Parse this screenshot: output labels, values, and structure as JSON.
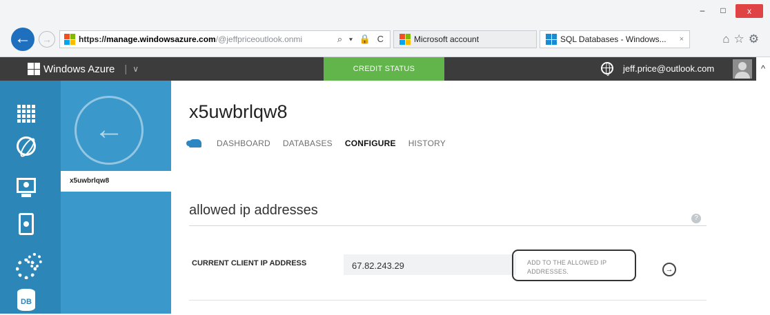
{
  "window": {
    "minimize": "–",
    "maximize": "□",
    "close": "x"
  },
  "browser": {
    "address": {
      "scheme": "https://",
      "host": "manage.windowsazure.com",
      "path": "/@jeffpriceoutlook.onmi"
    },
    "address_tools": "⌕ ▾ 🔒 C",
    "tabs": [
      {
        "label": "Microsoft account",
        "active": false
      },
      {
        "label": "SQL Databases - Windows...",
        "active": true,
        "close": "×"
      }
    ],
    "toolbar_icons": [
      "home-icon",
      "favorites-star-icon",
      "settings-gear-icon"
    ]
  },
  "portal_bar": {
    "brand": "Windows Azure",
    "credit_status": "CREDIT STATUS",
    "user_email": "jeff.price@outlook.com"
  },
  "left_rail": {
    "icons": [
      "all-items-grid-icon",
      "web-sites-globe-icon",
      "virtual-machines-icon",
      "mobile-services-icon",
      "cloud-services-icon",
      "sql-databases-icon"
    ],
    "db_label": "DB"
  },
  "panel": {
    "selected_item": "x5uwbrlqw8"
  },
  "main": {
    "server_name": "x5uwbrlqw8",
    "tabs": [
      "DASHBOARD",
      "DATABASES",
      "CONFIGURE",
      "HISTORY"
    ],
    "current_tab": "CONFIGURE",
    "section_title": "allowed ip addresses",
    "field_label": "CURRENT CLIENT IP ADDRESS",
    "ip_value": "67.82.243.29",
    "add_link": "ADD TO THE ALLOWED IP ADDRESSES."
  },
  "colors": {
    "azure_blue": "#2c87b8",
    "panel_blue": "#3a98ca",
    "credit_green": "#61b54a",
    "top_bar": "#3c3c3c",
    "close_red": "#e04343"
  }
}
